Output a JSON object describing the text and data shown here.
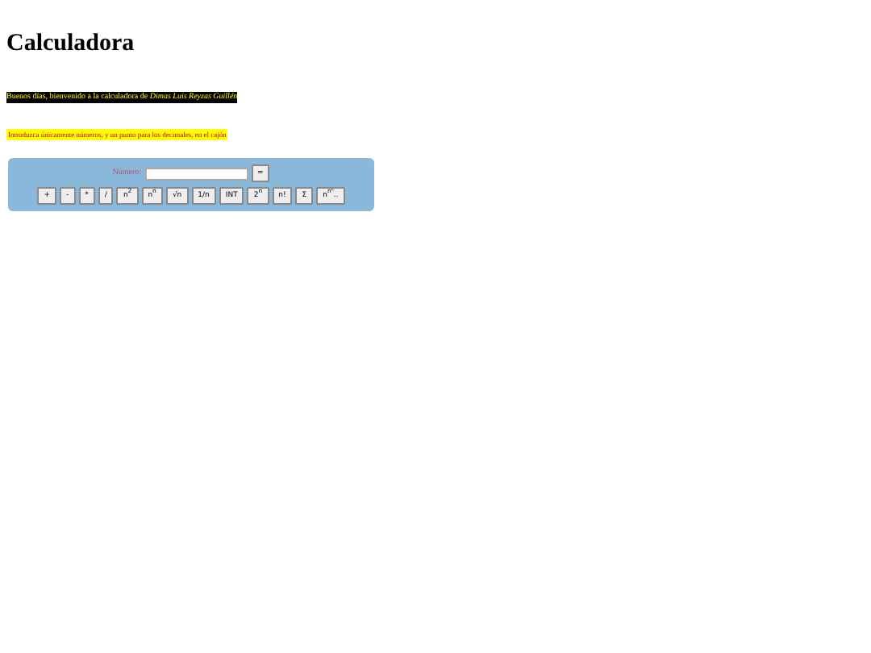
{
  "title": "Calculadora",
  "greeting": "Buenos días, bienvenido a la calculadora de *Dimas Luis Reyzas Guillén*",
  "instructions": "Introduzca únicamente números, y un punto para los decimales, en el cajón",
  "calculator": {
    "label": "Número:",
    "equals": "=",
    "buttons": [
      "+",
      "-",
      "*",
      "/",
      "n$^{2}$",
      "n$^{n}$",
      "√n",
      "1/n",
      "INT",
      "2$^{n}$",
      "n!",
      "Σ",
      "n$^{nⁿ}$.."
    ]
  }
}
